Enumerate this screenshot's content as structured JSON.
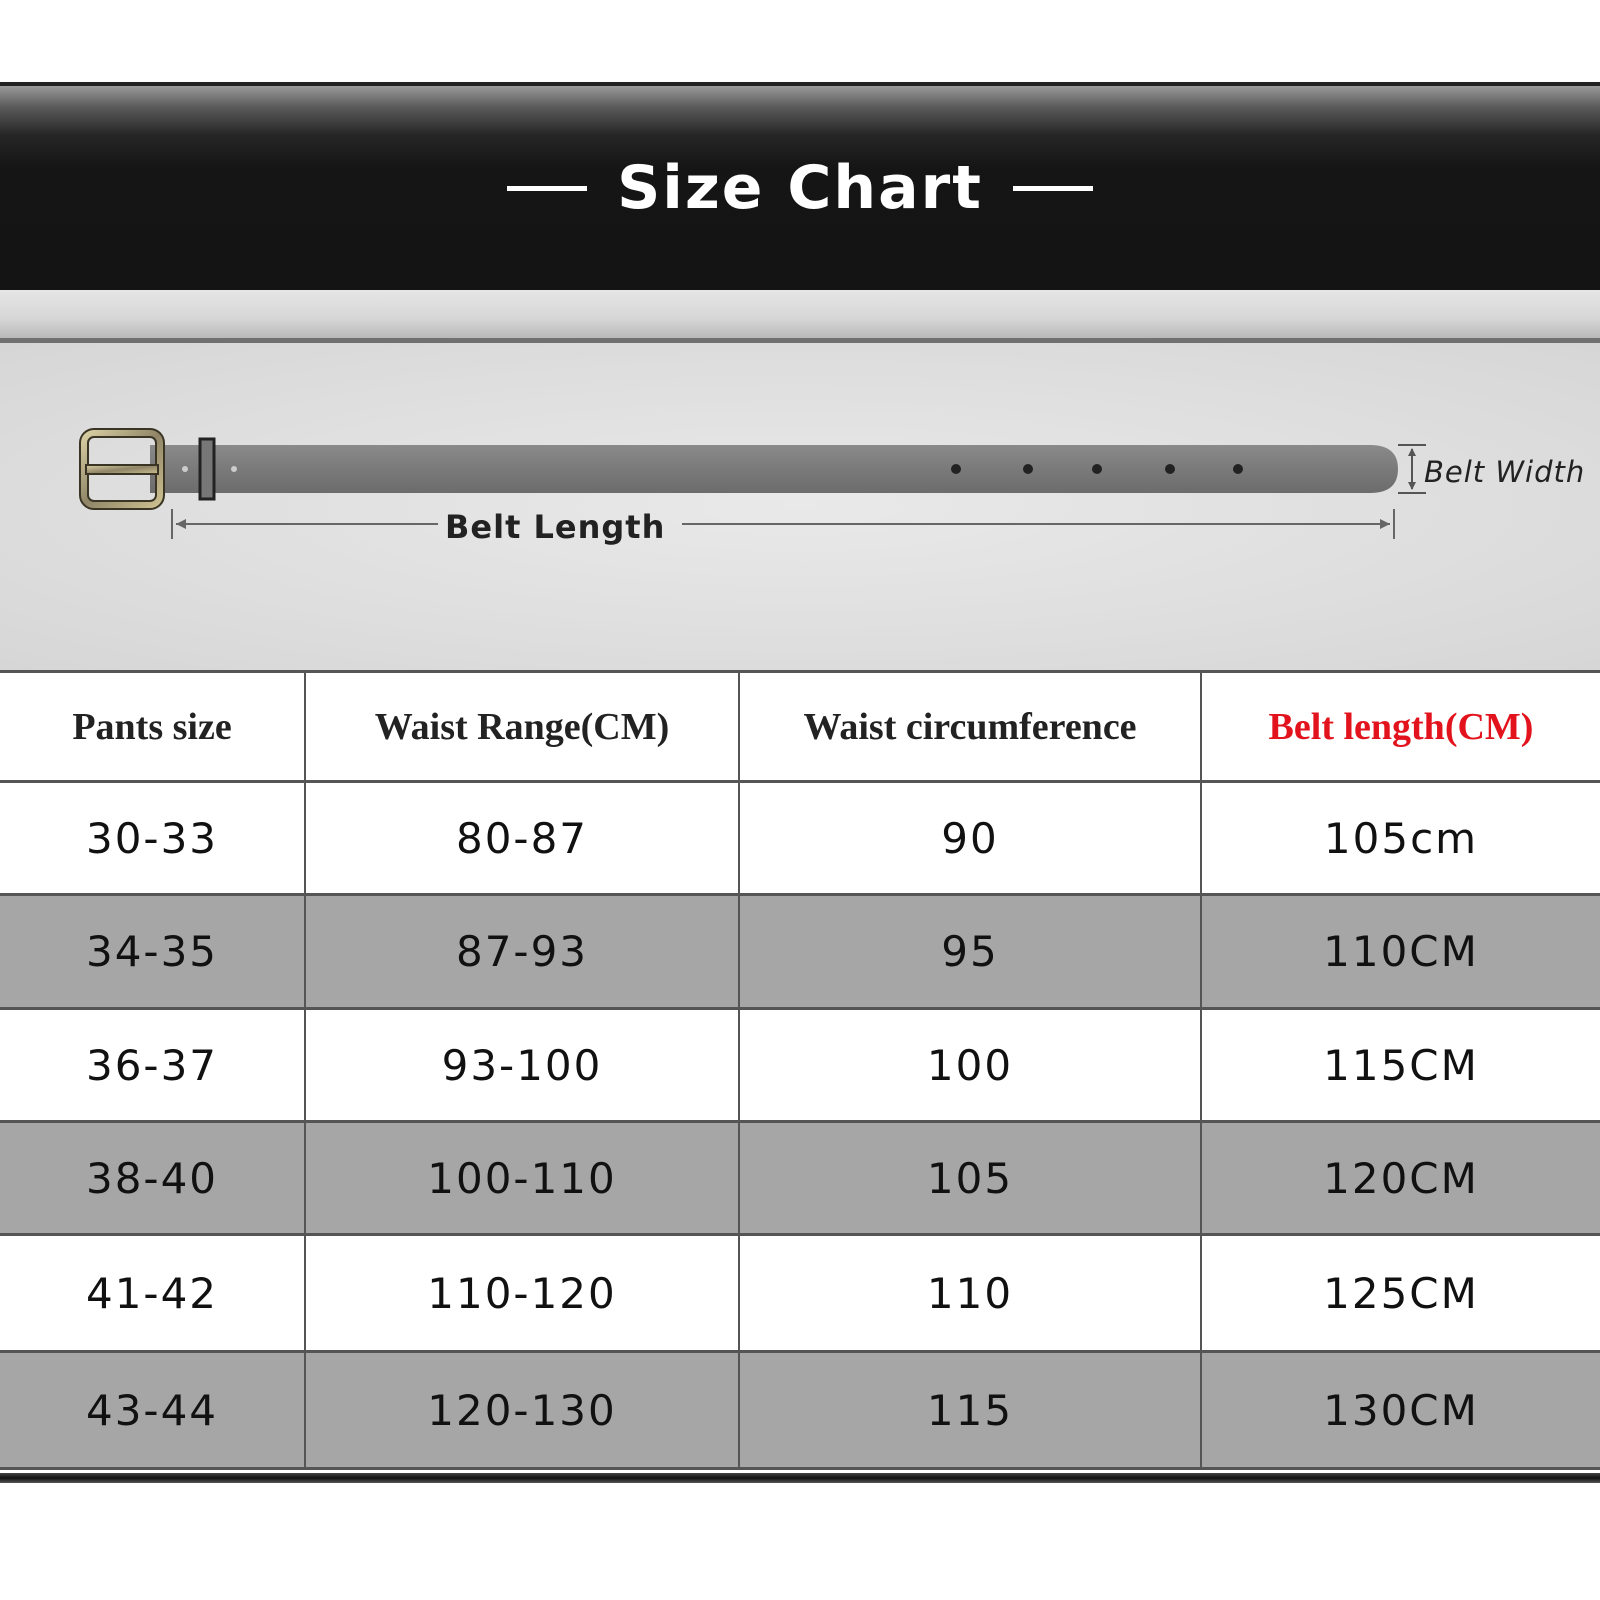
{
  "header": {
    "title": "Size Chart"
  },
  "diagram": {
    "belt_length_label": "Belt Length",
    "belt_width_label": "Belt Width"
  },
  "table": {
    "columns": [
      "Pants size",
      "Waist Range(CM)",
      "Waist circumference",
      "Belt length(CM)"
    ],
    "highlight_color": "#e3131d",
    "rows": [
      [
        "30-33",
        "80-87",
        "90",
        "105cm"
      ],
      [
        "34-35",
        "87-93",
        "95",
        "110CM"
      ],
      [
        "36-37",
        "93-100",
        "100",
        "115CM"
      ],
      [
        "38-40",
        "100-110",
        "105",
        "120CM"
      ],
      [
        "41-42",
        "110-120",
        "110",
        "125CM"
      ],
      [
        "43-44",
        "120-130",
        "115",
        "130CM"
      ]
    ]
  }
}
